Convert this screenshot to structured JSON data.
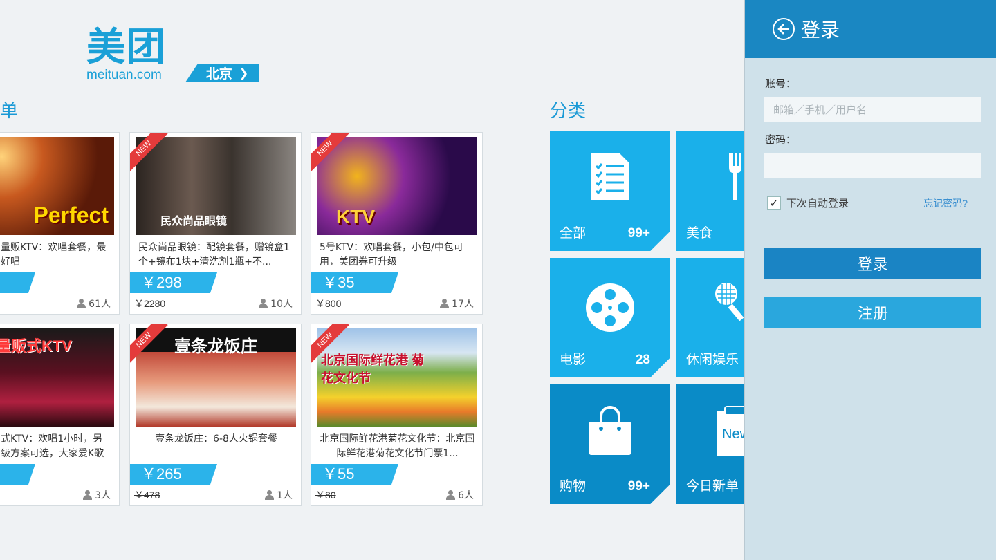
{
  "header": {
    "logo_cn": "美团",
    "logo_en": "meituan.com",
    "city": "北京"
  },
  "sections": {
    "deals_title": "新单",
    "category_title": "分类"
  },
  "deals": [
    {
      "image_text": "Perfect",
      "new": false,
      "desc": "量贩KTV：欢唱套餐，最\n好唱",
      "price": "",
      "orig": "",
      "people": "61人"
    },
    {
      "image_text": "民众尚品眼镜",
      "new": true,
      "new_label": "NEW",
      "desc": "民众尚品眼镜：配镜套餐，赠镜盒1个+镜布1块+清洗剂1瓶+不...",
      "price": "￥298",
      "orig": "￥2280",
      "people": "10人"
    },
    {
      "image_text": "KTV",
      "new": true,
      "new_label": "NEW",
      "desc": "5号KTV：欢唱套餐，小包/中包可用，美团券可升级",
      "price": "￥35",
      "orig": "￥800",
      "people": "17人"
    },
    {
      "image_text": "量贩式KTV",
      "new": false,
      "desc": "式KTV：欢唱1小时，另\n级方案可选，大家爱K歌",
      "price": "",
      "orig": "",
      "people": "3人"
    },
    {
      "image_text": "壹条龙饭庄",
      "new": true,
      "new_label": "NEW",
      "desc": "壹条龙饭庄：6-8人火锅套餐",
      "price": "￥265",
      "orig": "￥478",
      "people": "1人"
    },
    {
      "image_text": "北京国际鲜花港 菊花文化节",
      "new": true,
      "new_label": "NEW",
      "desc": "北京国际鲜花港菊花文化节：北京国际鲜花港菊花文化节门票1...",
      "price": "￥55",
      "orig": "￥80",
      "people": "6人"
    }
  ],
  "categories": [
    {
      "label": "全部",
      "count": "99+",
      "icon": "list-icon"
    },
    {
      "label": "美食",
      "count": "",
      "icon": "fork-knife-icon"
    },
    {
      "label": "电影",
      "count": "28",
      "icon": "film-reel-icon"
    },
    {
      "label": "休闲娱乐",
      "count": "",
      "icon": "racket-icon"
    },
    {
      "label": "购物",
      "count": "99+",
      "icon": "shopping-bag-icon"
    },
    {
      "label": "今日新单",
      "count": "",
      "icon": "new-clipboard-icon",
      "icon_text": "New"
    }
  ],
  "login": {
    "title": "登录",
    "account_label": "账号：",
    "account_placeholder": "邮箱／手机／用户名",
    "password_label": "密码：",
    "remember_label": "下次自动登录",
    "remember_checked": true,
    "forgot_label": "忘记密码?",
    "login_button": "登录",
    "register_button": "注册"
  },
  "colors": {
    "accent": "#1aa0d7",
    "tile": "#1ab0ea",
    "tile_dark": "#0a8bc7",
    "panel_header": "#1a87c2",
    "ribbon": "#e43b3b"
  }
}
